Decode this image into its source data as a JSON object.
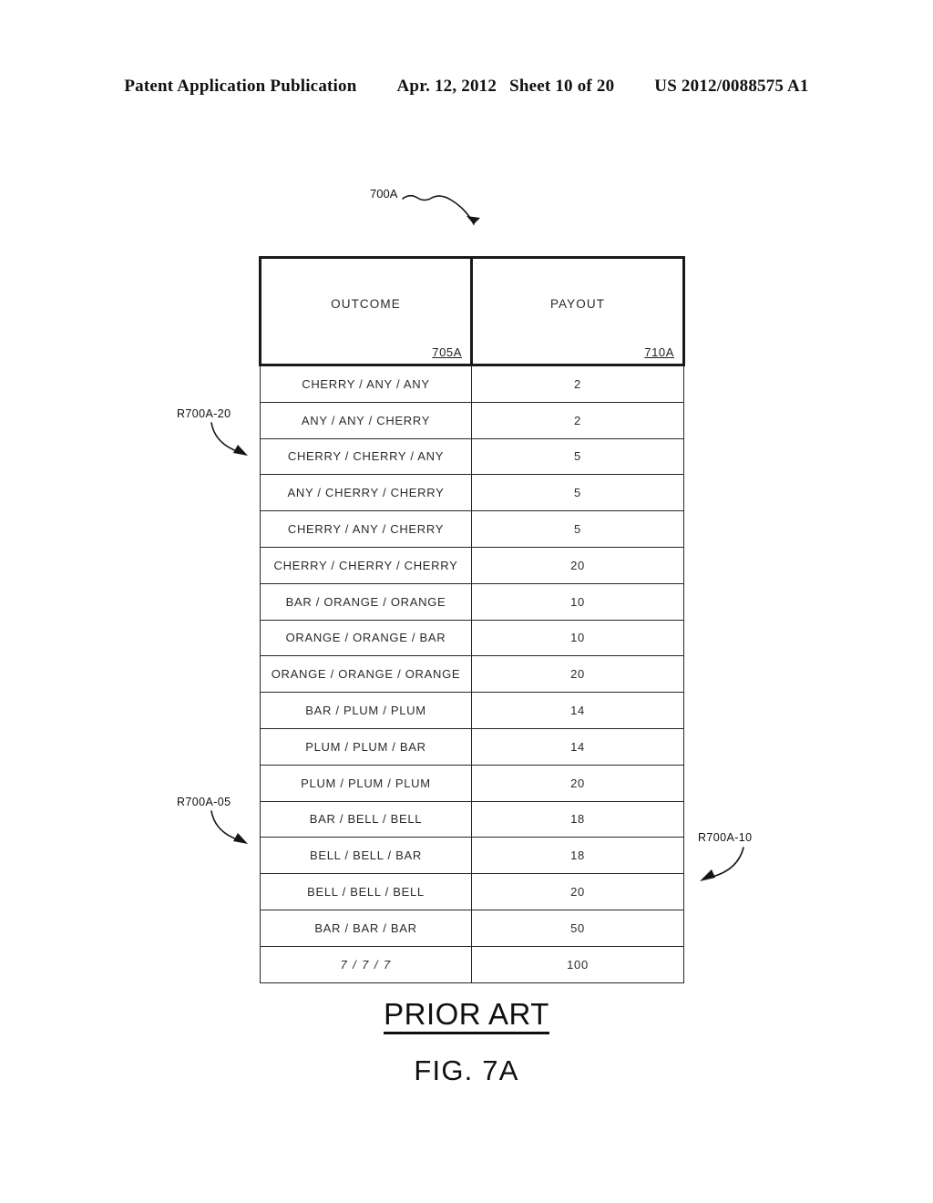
{
  "header": {
    "publication": "Patent Application Publication",
    "date": "Apr. 12, 2012",
    "sheet": "Sheet 10 of 20",
    "doc_number": "US 2012/0088575 A1"
  },
  "figure": {
    "top_callout": "700A",
    "table": {
      "columns": [
        {
          "label": "OUTCOME",
          "ref": "705A"
        },
        {
          "label": "PAYOUT",
          "ref": "710A"
        }
      ],
      "rows": [
        {
          "outcome": "CHERRY / ANY / ANY",
          "payout": "2"
        },
        {
          "outcome": "ANY / ANY / CHERRY",
          "payout": "2"
        },
        {
          "outcome": "CHERRY / CHERRY / ANY",
          "payout": "5"
        },
        {
          "outcome": "ANY / CHERRY / CHERRY",
          "payout": "5"
        },
        {
          "outcome": "CHERRY / ANY / CHERRY",
          "payout": "5"
        },
        {
          "outcome": "CHERRY / CHERRY / CHERRY",
          "payout": "20"
        },
        {
          "outcome": "BAR / ORANGE / ORANGE",
          "payout": "10"
        },
        {
          "outcome": "ORANGE / ORANGE / BAR",
          "payout": "10"
        },
        {
          "outcome": "ORANGE / ORANGE / ORANGE",
          "payout": "20"
        },
        {
          "outcome": "BAR / PLUM / PLUM",
          "payout": "14"
        },
        {
          "outcome": "PLUM / PLUM / BAR",
          "payout": "14"
        },
        {
          "outcome": "PLUM / PLUM / PLUM",
          "payout": "20"
        },
        {
          "outcome": "BAR / BELL / BELL",
          "payout": "18"
        },
        {
          "outcome": "BELL / BELL / BAR",
          "payout": "18"
        },
        {
          "outcome": "BELL / BELL / BELL",
          "payout": "20"
        },
        {
          "outcome": "BAR / BAR / BAR",
          "payout": "50"
        },
        {
          "outcome": "7 / 7 / 7",
          "payout": "100"
        }
      ]
    },
    "reference_callouts": [
      {
        "label": "R700A-20"
      },
      {
        "label": "R700A-05"
      },
      {
        "label": "R700A-10"
      }
    ],
    "caption": {
      "prior_art": "PRIOR ART",
      "figure_number": "FIG. 7A"
    }
  },
  "colors": {
    "ink": "#111111",
    "rule": "#1a1a1a",
    "paper": "#ffffff"
  }
}
